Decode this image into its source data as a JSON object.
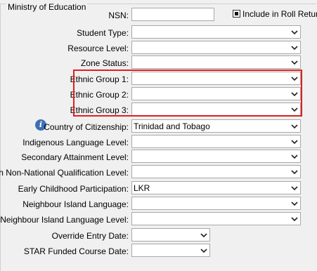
{
  "group_title": "Ministry of Education",
  "nsn": {
    "label": "NSN:",
    "value": ""
  },
  "roll_return": {
    "label": "Include in Roll Return",
    "checked": true
  },
  "fields": [
    {
      "label": "Student Type:",
      "value": ""
    },
    {
      "label": "Resource Level:",
      "value": ""
    },
    {
      "label": "Zone Status:",
      "value": ""
    },
    {
      "label": "Ethnic Group 1:",
      "value": ""
    },
    {
      "label": "Ethnic Group 2:",
      "value": ""
    },
    {
      "label": "Ethnic Group 3:",
      "value": ""
    },
    {
      "label": "Country of Citizenship:",
      "value": "Trinidad and Tobago"
    },
    {
      "label": "Indigenous Language Level:",
      "value": ""
    },
    {
      "label": "Secondary Attainment Level:",
      "value": ""
    },
    {
      "label": "High Non-National Qualification Level:",
      "value": ""
    },
    {
      "label": "Early Childhood Participation:",
      "value": "LKR"
    },
    {
      "label": "Neighbour Island Language:",
      "value": ""
    },
    {
      "label": "Neighbour Island Language Level:",
      "value": ""
    }
  ],
  "dates": [
    {
      "label": "Override Entry Date:",
      "value": ""
    },
    {
      "label": "STAR Funded Course Date:",
      "value": ""
    }
  ],
  "info_icon_glyph": "i",
  "colors": {
    "highlight": "#e02020",
    "info_icon": "#3d6fb6"
  }
}
